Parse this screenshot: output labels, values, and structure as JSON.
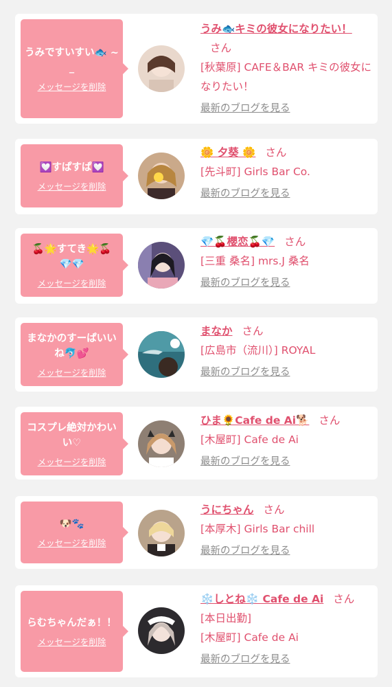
{
  "delete_label": "メッセージを削除",
  "san_label": "さん",
  "blog_label": "最新のブログを見る",
  "colors": {
    "accent_pink": "#f89aa6",
    "text_pink": "#e0506e",
    "link_gray": "#8c8c8c"
  },
  "cards": [
    {
      "message": "うみですいすい🐟 ~ _",
      "cast_name": "うみ🐟キミの彼女になりたい！",
      "shop_lines": [
        "[秋葉原] CAFE＆BAR キミの彼女になりたい！"
      ]
    },
    {
      "message": "💟すぱすぱ💟",
      "cast_name": "🌼 夕葵 🌼",
      "shop_lines": [
        "[先斗町] Girls Bar Co."
      ]
    },
    {
      "message": "🍒🌟すてき🌟🍒 💎💎",
      "cast_name": "💎🍒櫻恋🍒💎",
      "shop_lines": [
        "[三重 桑名] mrs.J 桑名"
      ]
    },
    {
      "message": "まなかのすーぱいいね🐬💕",
      "cast_name": "まなか",
      "shop_lines": [
        "[広島市（流川）] ROYAL"
      ]
    },
    {
      "message": "コスプレ絶対かわいい♡",
      "cast_name": "ひま🌻Cafe de Ai🐕",
      "shop_lines": [
        "[木屋町] Cafe de Ai"
      ]
    },
    {
      "message": "🐶🐾",
      "cast_name": "うにちゃん",
      "shop_lines": [
        "[本厚木] Girls Bar chill"
      ]
    },
    {
      "message": "らむちゃんだぁ！！",
      "cast_name": "❄️しとね❄️ Cafe de Ai",
      "shop_lines": [
        "[本日出勤]",
        "[木屋町] Cafe de Ai"
      ]
    }
  ]
}
